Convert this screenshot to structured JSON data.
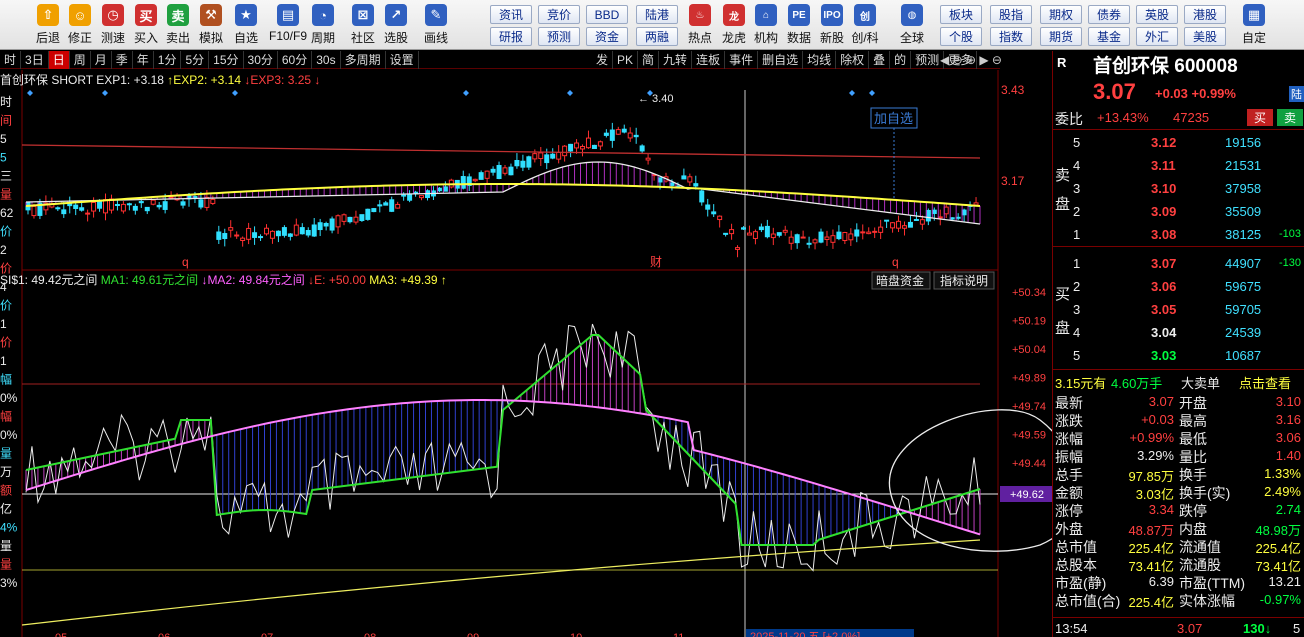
{
  "toolbar": {
    "buttons": [
      {
        "label": "后退",
        "icon": "⇧",
        "color": "#f0a000",
        "name": "back-button"
      },
      {
        "label": "修正",
        "icon": "☺",
        "color": "#f0a000",
        "name": "correct-button"
      },
      {
        "label": "测速",
        "icon": "◷",
        "color": "#d03030",
        "name": "speed-test-button"
      },
      {
        "label": "买入",
        "icon": "买",
        "color": "#d03030",
        "name": "buy-button"
      },
      {
        "label": "卖出",
        "icon": "卖",
        "color": "#20a040",
        "name": "sell-button"
      },
      {
        "label": "模拟",
        "icon": "⚒",
        "color": "#b05020",
        "name": "simulate-button"
      },
      {
        "label": "自选",
        "icon": "★",
        "color": "#3060c0",
        "name": "watchlist-button"
      },
      {
        "label": "F10/F9",
        "icon": "▤",
        "color": "#3060c0",
        "name": "f10-button"
      },
      {
        "label": "周期",
        "icon": "◔",
        "color": "#3060c0",
        "name": "period-button"
      },
      {
        "label": "社区",
        "icon": "⊠",
        "color": "#3060c0",
        "name": "community-button"
      },
      {
        "label": "选股",
        "icon": "↗",
        "color": "#3060c0",
        "name": "stock-select-button"
      },
      {
        "label": "画线",
        "icon": "✎",
        "color": "#3060c0",
        "name": "draw-line-button"
      }
    ],
    "text_buttons_top": [
      "资讯",
      "竞价",
      "BBD",
      "陆港"
    ],
    "text_buttons_bottom": [
      "研报",
      "预测",
      "资金",
      "两融"
    ],
    "buttons2": [
      {
        "label": "热点",
        "icon": "♨",
        "color": "#d03030",
        "name": "hot-button"
      },
      {
        "label": "龙虎",
        "icon": "龙",
        "color": "#d03030",
        "name": "dragon-tiger-button"
      },
      {
        "label": "机构",
        "icon": "⌂",
        "color": "#3060c0",
        "name": "institution-button"
      },
      {
        "label": "数据",
        "icon": "PE",
        "color": "#3060c0",
        "name": "data-button"
      },
      {
        "label": "新股",
        "icon": "IPO",
        "color": "#3060c0",
        "name": "ipo-button"
      },
      {
        "label": "创/科",
        "icon": "创",
        "color": "#3060c0",
        "name": "chuangke-button"
      },
      {
        "label": "全球",
        "icon": "◍",
        "color": "#3060c0",
        "name": "global-button"
      }
    ],
    "text_buttons2_top": [
      "板块",
      "股指",
      "期权",
      "债券",
      "英股",
      "港股"
    ],
    "text_buttons2_bottom": [
      "个股",
      "指数",
      "期货",
      "基金",
      "外汇",
      "美股"
    ],
    "custom_label": "自定"
  },
  "period_bar": {
    "items": [
      "时",
      "3日",
      "日",
      "周",
      "月",
      "季",
      "年",
      "1分",
      "5分",
      "15分",
      "30分",
      "60分",
      "30s",
      "多周期",
      "设置"
    ],
    "active": "日",
    "right_items": [
      "发",
      "PK",
      "简",
      "九转",
      "连板",
      "事件",
      "删自选",
      "均线",
      "除权",
      "叠",
      "的",
      "预测",
      "更多"
    ]
  },
  "main_chart": {
    "legend": {
      "name": "首创环保",
      "text": " SHORT EXP1: +3.18",
      "exp2": "EXP2: +3.14",
      "exp3": "EXP3: 3.25"
    },
    "price_labels": [
      "3.43",
      "3.17"
    ],
    "peak_label": "3.40",
    "add_watch_label": "加自选",
    "event_labels": [
      "q",
      "财",
      "q"
    ]
  },
  "sub_chart": {
    "legend": {
      "si": "SI$1: 49.42元之间",
      "ma1": "MA1: 49.61元之间",
      "ma2": "MA2: 49.84元之间",
      "e": "E: +50.00",
      "ma3": "MA3: +49.39"
    },
    "buttons": [
      "暗盘资金",
      "指标说明"
    ],
    "axis_labels": [
      "+50.34",
      "+50.19",
      "+50.04",
      "+49.89",
      "+49.74",
      "+49.59",
      "+49.44",
      "+49.29"
    ],
    "current_tag": "+49.62",
    "bottom_label": "2025-11-20 五 [+2.0%]"
  },
  "x_axis_labels": [
    "05",
    "06",
    "07",
    "08",
    "09",
    "10",
    "11",
    "12"
  ],
  "left_panel": [
    "时",
    "间",
    "5",
    "5",
    "三",
    "量",
    "62",
    "价",
    "2",
    "价",
    "4",
    "价",
    "1",
    "价",
    "1",
    "幅",
    "0%",
    "幅",
    "0%",
    "量",
    "万",
    "额",
    "亿",
    "4%",
    "量",
    "量",
    "3%"
  ],
  "quote": {
    "market_tag": "R",
    "name": "首创环保",
    "code": "600008",
    "price": "3.07",
    "change": "+0.03",
    "pct": "+0.99%",
    "lu": "陆",
    "buy_btn": "买",
    "sell_btn": "卖",
    "weibi_label": "委比",
    "weibi": "+13.43%",
    "weicha": "47235",
    "sell_label": [
      "卖",
      "盘"
    ],
    "buy_label": [
      "买",
      "盘"
    ],
    "asks": [
      {
        "lvl": "5",
        "price": "3.12",
        "vol": "19156",
        "chg": ""
      },
      {
        "lvl": "4",
        "price": "3.11",
        "vol": "21531",
        "chg": ""
      },
      {
        "lvl": "3",
        "price": "3.10",
        "vol": "37958",
        "chg": ""
      },
      {
        "lvl": "2",
        "price": "3.09",
        "vol": "35509",
        "chg": ""
      },
      {
        "lvl": "1",
        "price": "3.08",
        "vol": "38125",
        "chg": "-103"
      }
    ],
    "bids": [
      {
        "lvl": "1",
        "price": "3.07",
        "vol": "44907",
        "chg": "-130"
      },
      {
        "lvl": "2",
        "price": "3.06",
        "vol": "59675",
        "chg": ""
      },
      {
        "lvl": "3",
        "price": "3.05",
        "vol": "59705",
        "chg": ""
      },
      {
        "lvl": "4",
        "price": "3.04",
        "vol": "24539",
        "chg": ""
      },
      {
        "lvl": "5",
        "price": "3.03",
        "vol": "10687",
        "chg": ""
      }
    ],
    "bigorder": {
      "a": "3.15元有",
      "b": "4.60万手",
      "c": "大卖单",
      "d": "点击查看"
    },
    "stats": [
      {
        "l1": "最新",
        "v1": "3.07",
        "c1": "red",
        "l2": "开盘",
        "v2": "3.10",
        "c2": "red"
      },
      {
        "l1": "涨跌",
        "v1": "+0.03",
        "c1": "red",
        "l2": "最高",
        "v2": "3.16",
        "c2": "red"
      },
      {
        "l1": "涨幅",
        "v1": "+0.99%",
        "c1": "red",
        "l2": "最低",
        "v2": "3.06",
        "c2": "red"
      },
      {
        "l1": "振幅",
        "v1": "3.29%",
        "c1": "wht",
        "l2": "量比",
        "v2": "1.40",
        "c2": "red"
      },
      {
        "l1": "总手",
        "v1": "97.85万",
        "c1": "yel",
        "l2": "换手",
        "v2": "1.33%",
        "c2": "yel"
      },
      {
        "l1": "金额",
        "v1": "3.03亿",
        "c1": "yel",
        "l2": "换手(实)",
        "v2": "2.49%",
        "c2": "yel"
      },
      {
        "l1": "涨停",
        "v1": "3.34",
        "c1": "red",
        "l2": "跌停",
        "v2": "2.74",
        "c2": "grn"
      },
      {
        "l1": "外盘",
        "v1": "48.87万",
        "c1": "red",
        "l2": "内盘",
        "v2": "48.98万",
        "c2": "grn"
      },
      {
        "l1": "总市值",
        "v1": "225.4亿",
        "c1": "yel",
        "l2": "流通值",
        "v2": "225.4亿",
        "c2": "yel"
      },
      {
        "l1": "总股本",
        "v1": "73.41亿",
        "c1": "yel",
        "l2": "流通股",
        "v2": "73.41亿",
        "c2": "yel"
      },
      {
        "l1": "市盈(静)",
        "v1": "6.39",
        "c1": "wht",
        "l2": "市盈(TTM)",
        "v2": "13.21",
        "c2": "wht"
      },
      {
        "l1": "总市值(合)",
        "v1": "225.4亿",
        "c1": "yel",
        "l2": "实体涨幅",
        "v2": "-0.97%",
        "c2": "grn"
      }
    ],
    "tick": {
      "time": "13:54",
      "price": "3.07",
      "vol": "130",
      "dir": "↓",
      "num": "5"
    }
  }
}
